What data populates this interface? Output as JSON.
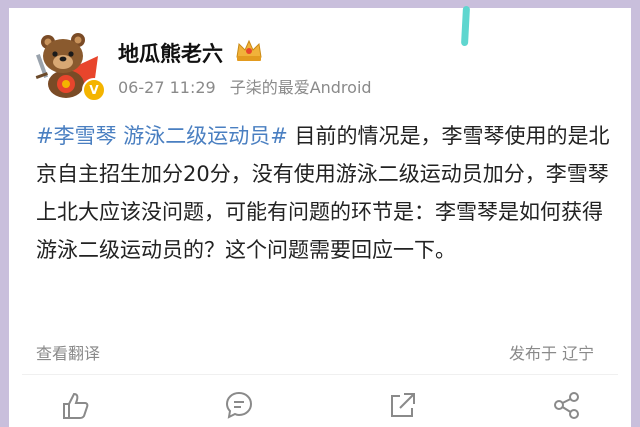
{
  "post": {
    "username": "地瓜熊老六",
    "time": "06-27 11:29",
    "source": "子柒的最爱Android",
    "topic": "#李雪琴 游泳二级运动员#",
    "body": " 目前的情况是，李雪琴使用的是北京自主招生加分20分，没有使用游泳二级运动员加分，李雪琴上北大应该没问题，可能有问题的环节是：李雪琴是如何获得游泳二级运动员的？这个问题需要回应一下。",
    "translate_label": "查看翻译",
    "location": "发布于 辽宁",
    "verified_badge": "V"
  },
  "icons": {
    "avatar": "bear-avatar-icon",
    "crown": "crown-badge-icon",
    "actions": [
      "like-icon",
      "comment-icon",
      "repost-icon",
      "share-icon"
    ]
  },
  "colors": {
    "background": "#c9bfdc",
    "topic": "#4a7fc1",
    "meta": "#8a8a8a",
    "badge": "#f4b400"
  }
}
